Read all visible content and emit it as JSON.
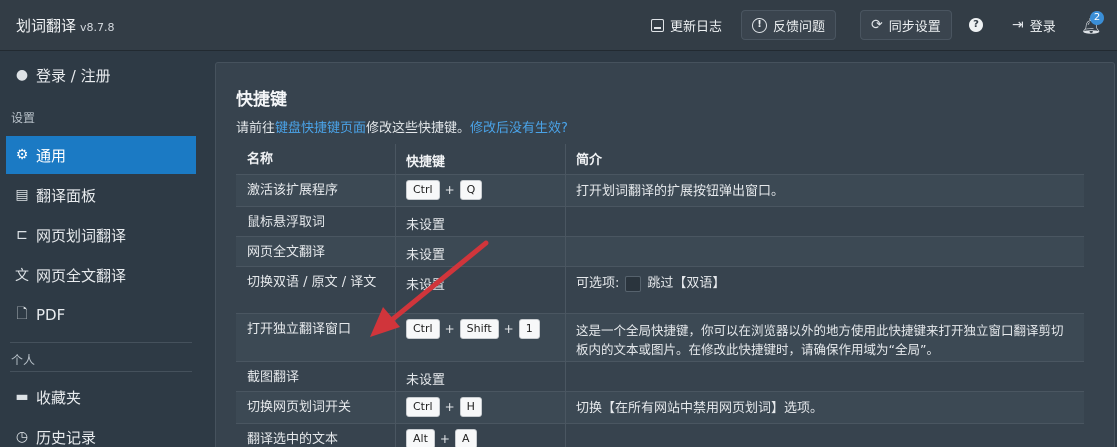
{
  "app": {
    "name": "划词翻译",
    "version": "v8.7.8"
  },
  "topbar": {
    "changelog": "更新日志",
    "feedback": "反馈问题",
    "sync": "同步设置",
    "help": "?",
    "login": "登录",
    "notification_count": "2"
  },
  "sidebar": {
    "login": "登录 / 注册",
    "section_settings": "设置",
    "items": [
      {
        "label": "通用",
        "icon": "gear-icon"
      },
      {
        "label": "翻译面板",
        "icon": "panel-icon"
      },
      {
        "label": "网页划词翻译",
        "icon": "selection-icon"
      },
      {
        "label": "网页全文翻译",
        "icon": "translate-icon"
      },
      {
        "label": "PDF",
        "icon": "file-icon"
      }
    ],
    "section_personal": "个人",
    "personal_items": [
      {
        "label": "收藏夹",
        "icon": "folder-icon"
      },
      {
        "label": "历史记录",
        "icon": "history-icon"
      }
    ]
  },
  "main": {
    "title": "快捷键",
    "subtitle_prefix": "请前往",
    "subtitle_link": "键盘快捷键页面",
    "subtitle_mid": "修改这些快捷键。",
    "subtitle_link2": "修改后没有生效?",
    "table": {
      "headers": [
        "名称",
        "快捷键",
        "简介"
      ],
      "rows": [
        {
          "name": "激活该扩展程序",
          "keys": [
            "Ctrl",
            "Q"
          ],
          "desc": "打开划词翻译的扩展按钮弹出窗口。"
        },
        {
          "name": "鼠标悬浮取词",
          "shortcut": "未设置",
          "desc": ""
        },
        {
          "name": "网页全文翻译",
          "shortcut": "未设置",
          "desc": ""
        },
        {
          "name": "切换双语 / 原文 / 译文",
          "shortcut": "未设置",
          "desc_prefix": "可选项:",
          "desc_option": "跳过【双语】"
        },
        {
          "name": "打开独立翻译窗口",
          "keys": [
            "Ctrl",
            "Shift",
            "1"
          ],
          "desc": "这是一个全局快捷键，你可以在浏览器以外的地方使用此快捷键来打开独立窗口翻译剪切板内的文本或图片。在修改此快捷键时，请确保作用域为“全局”。"
        },
        {
          "name": "截图翻译",
          "shortcut": "未设置",
          "desc": ""
        },
        {
          "name": "切换网页划词开关",
          "keys": [
            "Ctrl",
            "H"
          ],
          "desc": "切换【在所有网站中禁用网页划词】选项。"
        },
        {
          "name": "翻译选中的文本",
          "keys": [
            "Alt",
            "A"
          ],
          "desc": ""
        }
      ]
    }
  },
  "colors": {
    "accent": "#1b7ac4",
    "link": "#4aa3e8",
    "arrow": "#d0353b"
  }
}
